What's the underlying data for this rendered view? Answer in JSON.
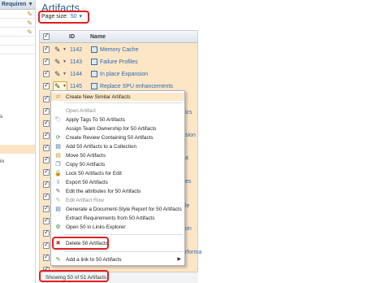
{
  "left_panel": {
    "header": "Requiren",
    "frag1": "s",
    "frag2": "in"
  },
  "title": "Artifacts",
  "page_size": {
    "label": "Page size:",
    "value": "50"
  },
  "grid": {
    "col_id": "ID",
    "col_name": "Name",
    "rows": [
      {
        "id": "1142",
        "name": "Memory Cache"
      },
      {
        "id": "1143",
        "name": "Failure Profiles"
      },
      {
        "id": "1144",
        "name": "In place Expansion"
      },
      {
        "id": "1145",
        "name": "Replace SPU enhancements"
      }
    ]
  },
  "right_fragments": [
    "ics",
    "sion",
    "a",
    "es",
    "le",
    "on",
    "rforma"
  ],
  "footer": "Showing 50 of 51 Artifacts",
  "menu": {
    "items": [
      {
        "label": "Create New Similar Artifacts",
        "icon": "create-similar-icon",
        "glyph": "⇄"
      },
      {
        "label": "Open Artifact",
        "icon": "none",
        "glyph": "",
        "disabled": true
      },
      {
        "label": "Apply Tags To 50 Artifacts",
        "icon": "tag-icon",
        "glyph": "🏷"
      },
      {
        "label": "Assign Team Ownership for 50 Artifacts",
        "icon": "none",
        "glyph": ""
      },
      {
        "label": "Create Review Containing 50 Artifacts",
        "icon": "review-icon",
        "glyph": "⟳"
      },
      {
        "label": "Add 50 Artifacts to a Collection",
        "icon": "collection-icon",
        "glyph": "▤"
      },
      {
        "label": "Move 50 Artifacts",
        "icon": "move-icon",
        "glyph": "▤"
      },
      {
        "label": "Copy 50 Artifacts",
        "icon": "copy-icon",
        "glyph": "❐"
      },
      {
        "label": "Lock 50 Artifacts for Edit",
        "icon": "lock-icon",
        "glyph": "🔒"
      },
      {
        "label": "Export 50 Artifacts",
        "icon": "export-icon",
        "glyph": "⇩"
      },
      {
        "label": "Edit the attributes for 50 Artifacts",
        "icon": "edit-attributes-icon",
        "glyph": "✎"
      },
      {
        "label": "Edit Artifact Row",
        "icon": "edit-row-icon",
        "glyph": "✎",
        "disabled": true
      },
      {
        "label": "Generate a Document-Style Report for 50 Artifacts",
        "icon": "report-icon",
        "glyph": "▤"
      },
      {
        "label": "Extract Requirements from 50 Artifacts",
        "icon": "none",
        "glyph": ""
      },
      {
        "label": "Open 50 in Links Explorer",
        "icon": "links-explorer-icon",
        "glyph": "⚙"
      },
      {
        "label": "Delete 50 Artifacts",
        "icon": "delete-icon",
        "glyph": "✖"
      },
      {
        "label": "Add a link to 50 Artifacts",
        "icon": "link-icon",
        "glyph": "✎"
      }
    ]
  }
}
